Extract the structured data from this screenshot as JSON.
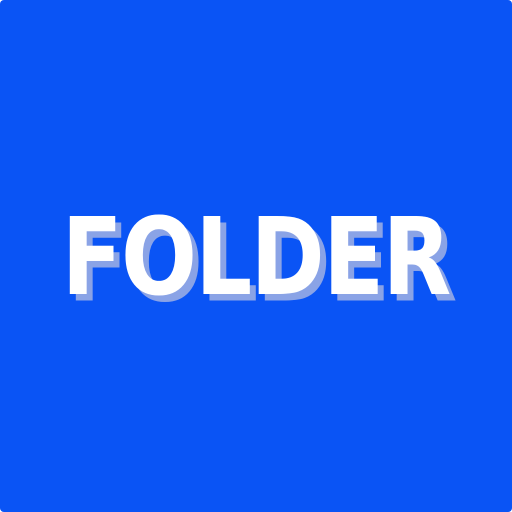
{
  "icon": {
    "label": "FOLDER",
    "background_color": "#0a54f5",
    "text_color": "#ffffff",
    "shadow_color": "#8aa3e6"
  }
}
